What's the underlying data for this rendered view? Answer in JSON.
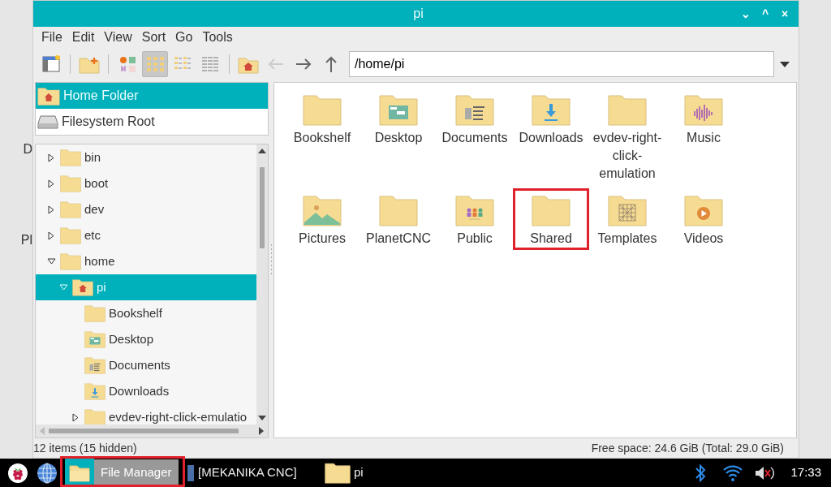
{
  "desktop_labels": [
    "D",
    "Pl"
  ],
  "window": {
    "title": "pi",
    "controls": [
      "⌄",
      "^",
      "×"
    ]
  },
  "menu": [
    "File",
    "Edit",
    "View",
    "Sort",
    "Go",
    "Tools"
  ],
  "toolbar": [
    {
      "kind": "new-window",
      "selected": false
    },
    {
      "kind": "sep"
    },
    {
      "kind": "new-folder",
      "selected": false
    },
    {
      "kind": "sep"
    },
    {
      "kind": "thumbnails",
      "selected": false
    },
    {
      "kind": "icons",
      "selected": true
    },
    {
      "kind": "compact",
      "selected": false
    },
    {
      "kind": "list",
      "selected": false
    },
    {
      "kind": "sep"
    },
    {
      "kind": "home",
      "selected": false
    },
    {
      "kind": "back",
      "selected": false,
      "disabled": true
    },
    {
      "kind": "forward",
      "selected": false,
      "disabled": false
    },
    {
      "kind": "up",
      "selected": false,
      "disabled": false
    }
  ],
  "location": {
    "value": "/home/pi"
  },
  "places": [
    {
      "label": "Home Folder",
      "kind": "home",
      "selected": true
    },
    {
      "label": "Filesystem Root",
      "kind": "drive",
      "selected": false
    }
  ],
  "tree": [
    {
      "label": "bin",
      "kind": "plain",
      "expanded": false,
      "selected": false
    },
    {
      "label": "boot",
      "kind": "plain",
      "expanded": false,
      "selected": false
    },
    {
      "label": "dev",
      "kind": "plain",
      "expanded": false,
      "selected": false
    },
    {
      "label": "etc",
      "kind": "plain",
      "expanded": false,
      "selected": false
    },
    {
      "label": "home",
      "kind": "plain",
      "expanded": true,
      "selected": false,
      "children": [
        {
          "label": "pi",
          "kind": "home",
          "expanded": true,
          "selected": true,
          "children": [
            {
              "label": "Bookshelf",
              "kind": "plain",
              "selected": false
            },
            {
              "label": "Desktop",
              "kind": "desktop",
              "selected": false
            },
            {
              "label": "Documents",
              "kind": "documents",
              "selected": false
            },
            {
              "label": "Downloads",
              "kind": "downloads",
              "selected": false
            },
            {
              "label": "evdev-right-click-emulatio",
              "kind": "plain",
              "expanded": false,
              "selected": false
            }
          ]
        }
      ]
    }
  ],
  "files": [
    {
      "name": "Bookshelf",
      "kind": "plain",
      "highlighted": false
    },
    {
      "name": "Desktop",
      "kind": "desktop",
      "highlighted": false
    },
    {
      "name": "Documents",
      "kind": "documents",
      "highlighted": false
    },
    {
      "name": "Downloads",
      "kind": "downloads",
      "highlighted": false
    },
    {
      "name": "evdev-right-click-emulation",
      "kind": "plain",
      "highlighted": false
    },
    {
      "name": "Music",
      "kind": "music",
      "highlighted": false
    },
    {
      "name": "Pictures",
      "kind": "pictures",
      "highlighted": false
    },
    {
      "name": "PlanetCNC",
      "kind": "plain",
      "highlighted": false
    },
    {
      "name": "Public",
      "kind": "public",
      "highlighted": false
    },
    {
      "name": "Shared",
      "kind": "plain",
      "highlighted": true
    },
    {
      "name": "Templates",
      "kind": "templates",
      "highlighted": false
    },
    {
      "name": "Videos",
      "kind": "videos",
      "highlighted": false
    }
  ],
  "status_bar": {
    "left": "12 items (15 hidden)",
    "right": "Free space: 24.6 GiB (Total: 29.0 GiB)"
  },
  "taskbar": {
    "launchers": [
      {
        "kind": "raspberry"
      },
      {
        "kind": "globe"
      },
      {
        "kind": "files",
        "highlighted": true,
        "tooltip": "File Manager"
      }
    ],
    "tasks": [
      {
        "label": "[MEKANIKA CNC]",
        "kind": "window"
      },
      {
        "label": "pi",
        "kind": "folder"
      }
    ],
    "tray": [
      {
        "kind": "bluetooth"
      },
      {
        "kind": "wifi"
      },
      {
        "kind": "volume-muted"
      }
    ],
    "clock": "17:33"
  }
}
